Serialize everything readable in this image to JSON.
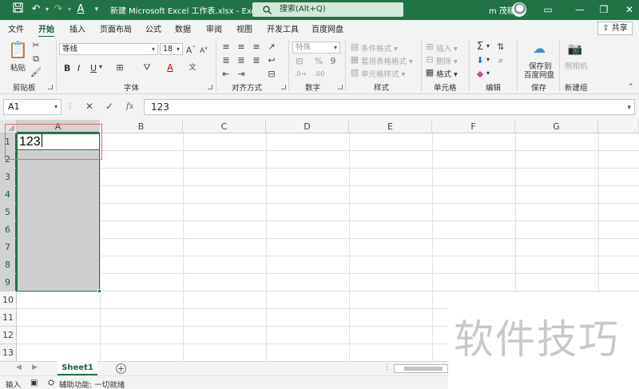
{
  "titlebar": {
    "doc_title": "新建 Microsoft Excel 工作表.xlsx  -  Excel",
    "search_placeholder": "搜索(Alt+Q)",
    "user": "m 茂稼",
    "bg_color": "#217346"
  },
  "tabs": [
    "文件",
    "开始",
    "插入",
    "页面布局",
    "公式",
    "数据",
    "审阅",
    "视图",
    "开发工具",
    "百度网盘"
  ],
  "active_tab": "开始",
  "share_label": "共享",
  "ribbon": {
    "clipboard": {
      "paste": "粘贴",
      "label": "剪贴板"
    },
    "font": {
      "name": "等线",
      "size": "18",
      "label": "字体",
      "bold": "B",
      "italic": "I",
      "underline": "U"
    },
    "alignment": {
      "label": "对齐方式"
    },
    "number": {
      "format": "特殊",
      "label": "数字"
    },
    "styles": {
      "conditional": "条件格式",
      "table": "套用表格格式",
      "cell": "单元格样式",
      "label": "样式"
    },
    "cells": {
      "insert": "插入",
      "delete": "删除",
      "format": "格式",
      "label": "单元格"
    },
    "editing": {
      "label": "编辑"
    },
    "save": {
      "line1": "保存到",
      "line2": "百度网盘",
      "label": "保存"
    },
    "new": {
      "camera": "照相机",
      "label": "新建组"
    }
  },
  "formula_bar": {
    "name_box": "A1",
    "fx": "fx",
    "value": "123"
  },
  "columns": [
    "A",
    "B",
    "C",
    "D",
    "E",
    "F",
    "G"
  ],
  "rows": [
    "1",
    "2",
    "3",
    "4",
    "5",
    "6",
    "7",
    "8",
    "9",
    "10",
    "11",
    "12",
    "13"
  ],
  "cells": {
    "A1": "123"
  },
  "sheets": [
    "Sheet1"
  ],
  "status": {
    "mode": "输入",
    "accessibility": "辅助功能: 一切就绪"
  },
  "watermark": "软件技巧"
}
